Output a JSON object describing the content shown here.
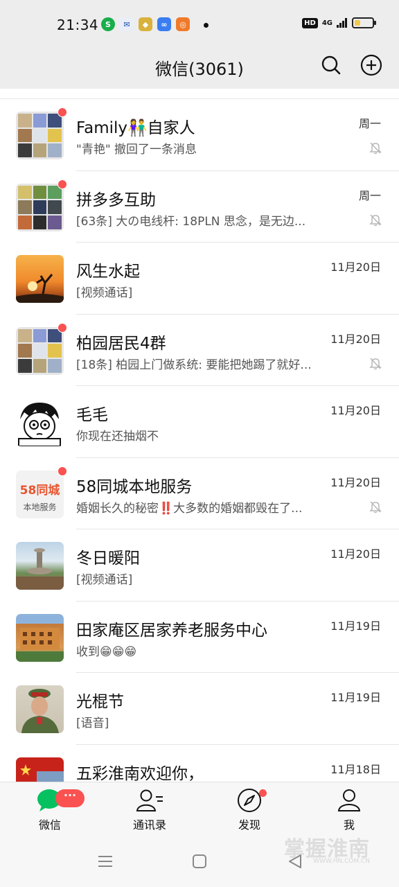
{
  "status_bar": {
    "time": "21:34",
    "hd_label": "HD",
    "network": "4G",
    "battery_level": 0.35
  },
  "header": {
    "title": "微信(3061)",
    "search_icon": "search-icon",
    "add_icon": "plus-circle-icon"
  },
  "chats": [
    {
      "name": "Family👫自家人",
      "preview": "\"青艳\" 撤回了一条消息",
      "time": "周一",
      "muted": true,
      "badge": true,
      "avatar": "group"
    },
    {
      "name": "拼多多互助",
      "preview": "[63条] 大の电线杆: 18PLN 思念，是无边...",
      "time": "周一",
      "muted": true,
      "badge": true,
      "avatar": "group"
    },
    {
      "name": "风生水起",
      "preview": "[视频通话]",
      "time": "11月20日",
      "muted": false,
      "badge": false,
      "avatar": "sunset"
    },
    {
      "name": "柏园居民4群",
      "preview": "[18条] 柏园上门做系统: 要能把她踢了就好...",
      "time": "11月20日",
      "muted": true,
      "badge": true,
      "avatar": "group"
    },
    {
      "name": "毛毛",
      "preview": "你现在还抽烟不",
      "time": "11月20日",
      "muted": false,
      "badge": false,
      "avatar": "cartoon"
    },
    {
      "name": "58同城本地服务",
      "preview": "婚姻长久的秘密‼️大多数的婚姻都毁在了...",
      "time": "11月20日",
      "muted": true,
      "badge": true,
      "avatar": "58"
    },
    {
      "name": "冬日暖阳",
      "preview": "[视频通话]",
      "time": "11月20日",
      "muted": false,
      "badge": false,
      "avatar": "fountain"
    },
    {
      "name": "田家庵区居家养老服务中心",
      "preview": "收到😁😁😁",
      "time": "11月19日",
      "muted": false,
      "badge": false,
      "avatar": "building"
    },
    {
      "name": "光棍节",
      "preview": "[语音]",
      "time": "11月19日",
      "muted": false,
      "badge": false,
      "avatar": "soldier"
    },
    {
      "name": "五彩淮南欢迎你，",
      "preview": "",
      "time": "11月18日",
      "muted": false,
      "badge": false,
      "avatar": "flag"
    }
  ],
  "avatar_58": {
    "line1": "58同城",
    "line2": "本地服务"
  },
  "tabbar": {
    "chats_label": "微信",
    "contacts_label": "通讯录",
    "discover_label": "发现",
    "me_label": "我",
    "unread_pill": "···"
  },
  "watermark": {
    "text": "掌握淮南",
    "sub": "WWW.HN.COM.CN"
  },
  "colors": {
    "accent_green": "#07c160",
    "badge_red": "#fa5151",
    "background": "#ededed"
  }
}
